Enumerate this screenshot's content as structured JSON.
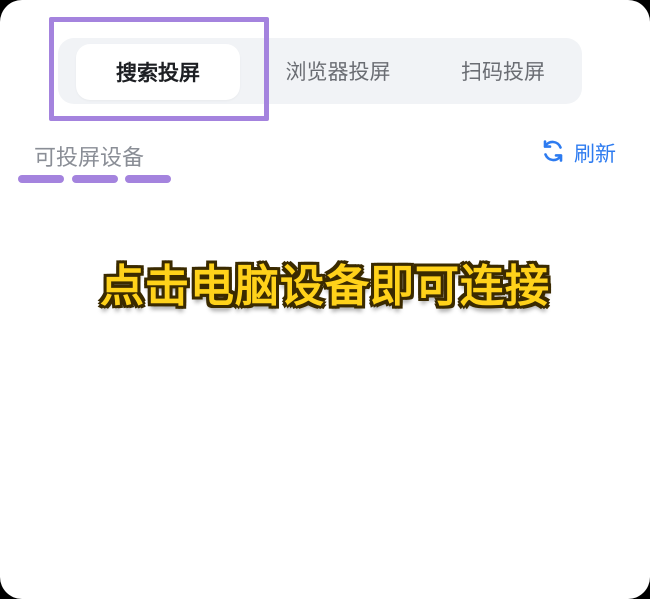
{
  "tabs": [
    {
      "label": "搜索投屏",
      "active": true
    },
    {
      "label": "浏览器投屏",
      "active": false
    },
    {
      "label": "扫码投屏",
      "active": false
    }
  ],
  "section": {
    "title": "可投屏设备",
    "refresh_label": "刷新",
    "refresh_icon": "refresh-icon"
  },
  "overlay_caption": "点击电脑设备即可连接",
  "colors": {
    "accent": "#2d7bf0",
    "highlight": "#a483de",
    "caption_fill": "#ffd21a",
    "caption_stroke": "#3a2a00"
  }
}
